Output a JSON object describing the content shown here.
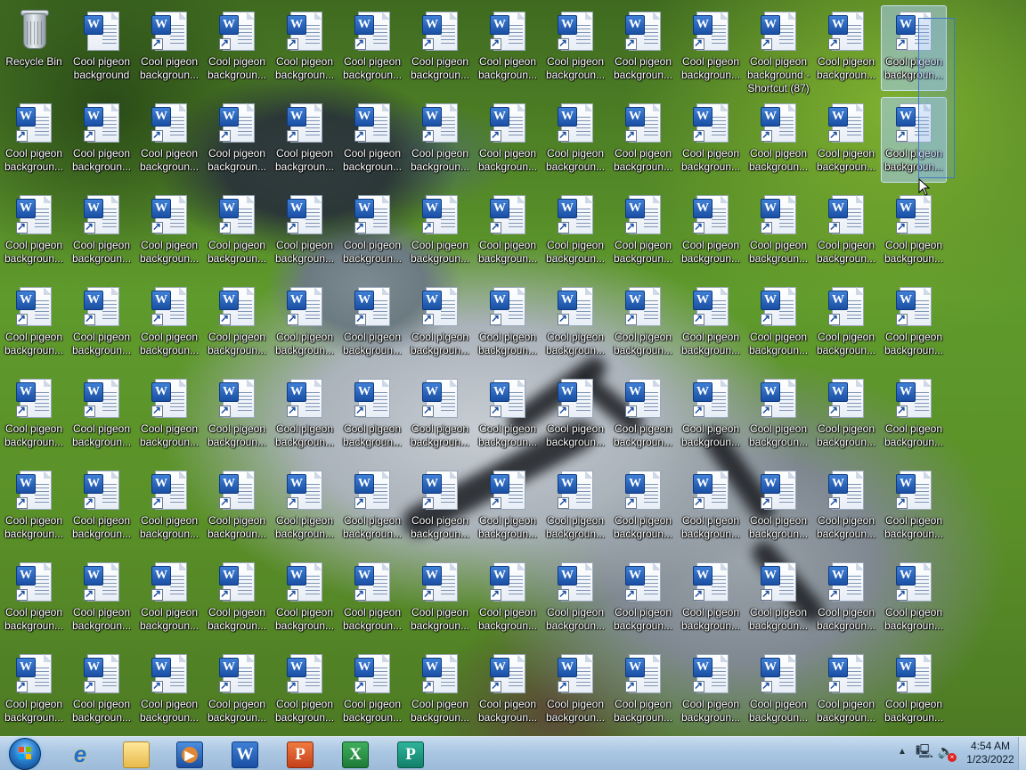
{
  "desktop": {
    "recycle_bin_label": "Recycle Bin",
    "first_icon_label": "Cool pigeon\nbackground",
    "generic_icon_label": "Cool pigeon\nbackgroun...",
    "special_icon_label": "Cool pigeon\nbackground -\nShortcut (87)",
    "selected_label": "Cool pigeon\nbackgroun..."
  },
  "taskbar": {
    "start_label": "Start",
    "pinned": [
      {
        "name": "Internet Explorer",
        "glyph": "e"
      },
      {
        "name": "Windows Explorer",
        "glyph": ""
      },
      {
        "name": "Windows Media Player",
        "glyph": "▶"
      },
      {
        "name": "Microsoft Word",
        "glyph": "W"
      },
      {
        "name": "Microsoft PowerPoint",
        "glyph": "P"
      },
      {
        "name": "Microsoft Excel",
        "glyph": "X"
      },
      {
        "name": "Microsoft Publisher",
        "glyph": "P"
      }
    ],
    "tray": {
      "chevron": "▲",
      "network_icon": "network-icon",
      "volume_icon": "volume-muted-icon",
      "time": "4:54 AM",
      "date": "1/23/2022"
    }
  }
}
